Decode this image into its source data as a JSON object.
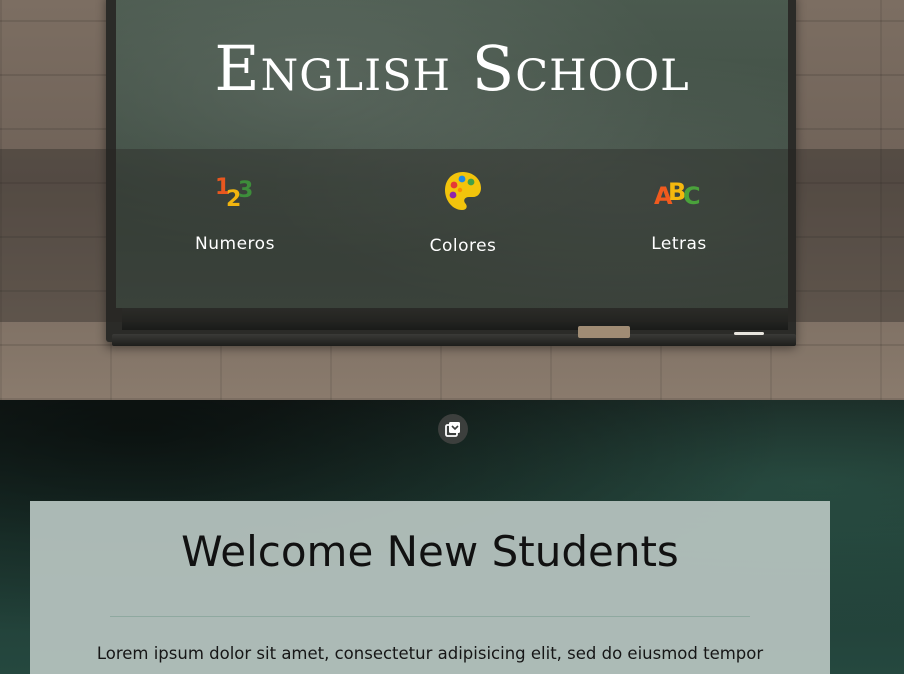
{
  "header": {
    "title": "English School"
  },
  "nav": {
    "items": [
      {
        "label": "Numeros",
        "icon": "numbers-123-icon"
      },
      {
        "label": "Colores",
        "icon": "color-palette-icon"
      },
      {
        "label": "Letras",
        "icon": "letters-abc-icon"
      }
    ],
    "icon_glyphs": {
      "numbers": [
        "1",
        "2",
        "3"
      ],
      "letters": [
        "A",
        "B",
        "C"
      ]
    }
  },
  "gallery": {
    "icon": "gallery-icon"
  },
  "welcome": {
    "title": "Welcome New Students",
    "text": "Lorem ipsum dolor sit amet, consectetur adipisicing elit, sed do eiusmod tempor"
  },
  "colors": {
    "number_one": "#e8571f",
    "number_two": "#f2b50f",
    "number_three": "#3d8d3a",
    "palette_body": "#f2c40c",
    "letter_a": "#f05a1e",
    "letter_b": "#f5b80e",
    "letter_c": "#4aa23b",
    "card_background": "#b2c0bb"
  }
}
